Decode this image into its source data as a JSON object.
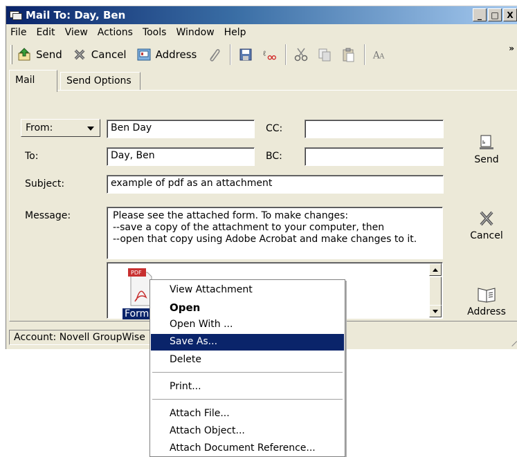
{
  "window": {
    "title": "Mail To: Day, Ben",
    "controls": {
      "minimize": "_",
      "maximize": "□",
      "close": "X"
    }
  },
  "menubar": [
    "File",
    "Edit",
    "View",
    "Actions",
    "Tools",
    "Window",
    "Help"
  ],
  "toolbar": {
    "send_label": "Send",
    "cancel_label": "Cancel",
    "address_label": "Address",
    "more": "»",
    "icons": [
      "send-icon",
      "cancel-icon",
      "address-book-icon",
      "paperclip-icon",
      "save-icon",
      "spell-check-icon",
      "cut-icon",
      "copy-icon",
      "paste-icon",
      "font-icon"
    ]
  },
  "tabs": [
    "Mail",
    "Send Options"
  ],
  "form": {
    "from_label": "From:",
    "from_value": "Ben Day",
    "to_label": "To:",
    "to_value": "Day, Ben",
    "cc_label": "CC:",
    "cc_value": "",
    "bc_label": "BC:",
    "bc_value": "",
    "subject_label": "Subject:",
    "subject_value": "example of pdf as an attachment",
    "message_label": "Message:",
    "message_lines": [
      "Please see the attached form. To make changes:",
      "--save a copy of the attachment to your computer, then",
      "--open that copy using Adobe Acrobat and make changes to it."
    ]
  },
  "attachment": {
    "icon_text": "PDF",
    "name": "Form."
  },
  "side_buttons": {
    "send": "Send",
    "cancel": "Cancel",
    "address": "Address"
  },
  "status": {
    "account": "Account: Novell GroupWise"
  },
  "context_menu": {
    "items": [
      "View Attachment",
      "Open",
      "Open With ...",
      "Save As...",
      "Delete",
      "Print...",
      "Attach File...",
      "Attach Object...",
      "Attach Document Reference..."
    ],
    "highlighted": "Save As..."
  },
  "colors": {
    "highlight": "#0a246a",
    "titlebar": "#0a246a",
    "chrome": "#ece9d8"
  }
}
